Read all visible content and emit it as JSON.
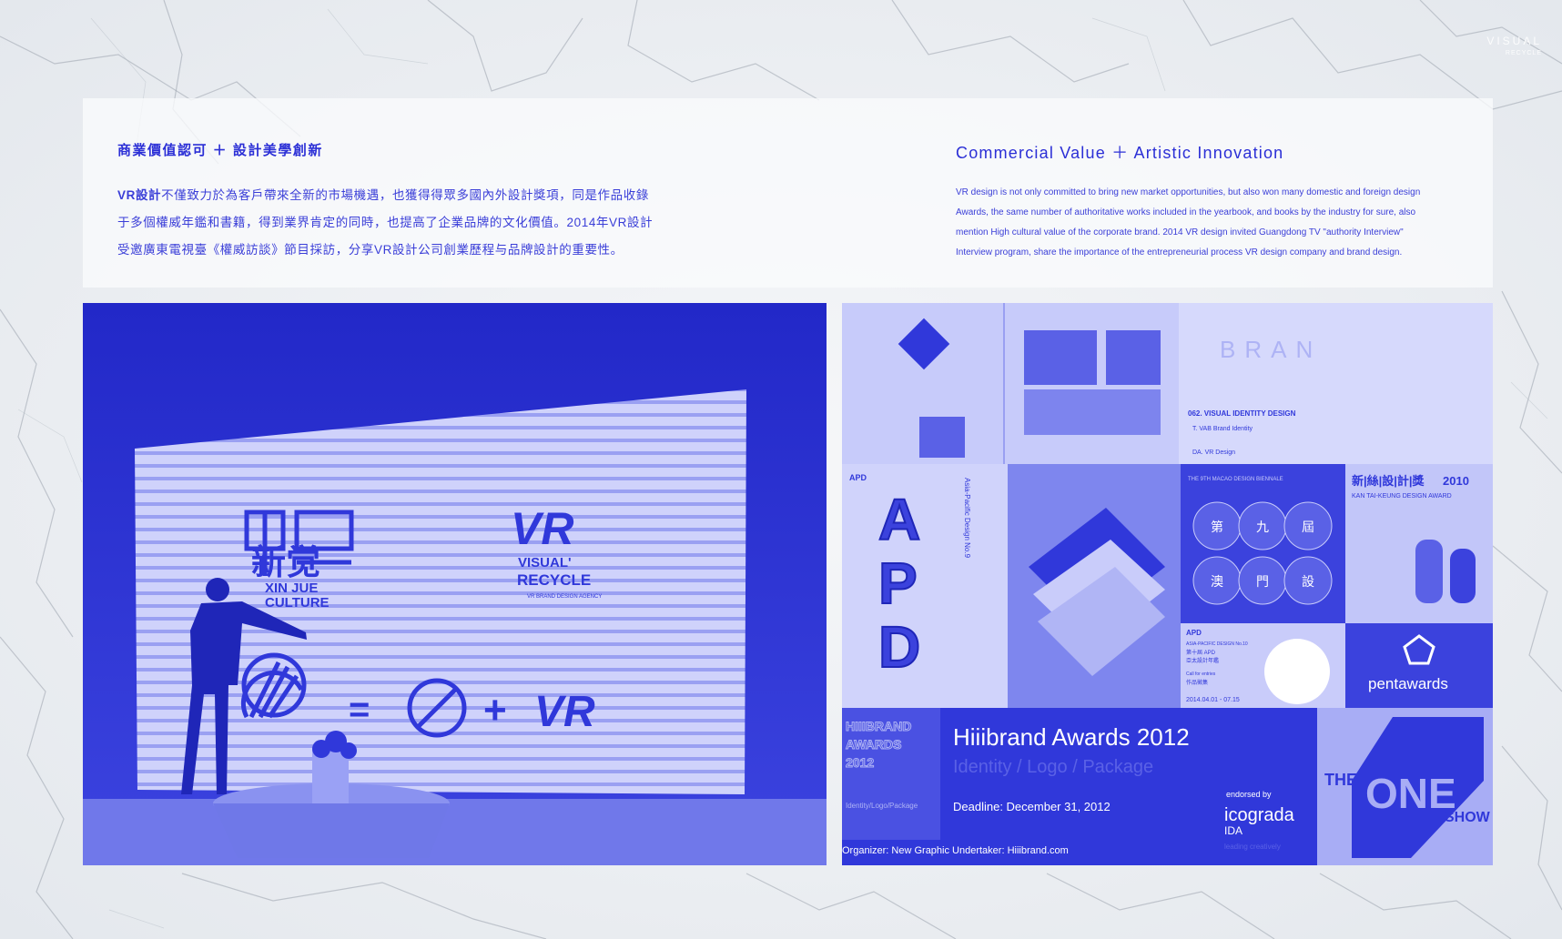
{
  "corner_logo": {
    "line1": "VISUAL",
    "line2": "RECYCLE"
  },
  "intro": {
    "zh": {
      "title": "商業價值認可 ＋ 設計美學創新",
      "lead": "VR設計",
      "body_line1": "不僅致力於為客戶帶來全新的市場機遇，也獲得得眾多國內外設計獎項，同是作品收錄",
      "body_line2": "于多個權威年鑑和書籍，得到業界肯定的同時，也提高了企業品牌的文化價值。2014年VR設計",
      "body_line3": "受邀廣東電視臺《權威訪談》節目採訪，分享VR設計公司創業歷程与品牌設計的重要性。"
    },
    "en": {
      "title": "Commercial Value ＋ Artistic Innovation",
      "body_line1": "VR design is not only committed to bring new market opportunities, but also won many domestic and foreign design",
      "body_line2": "Awards, the same number of authoritative works included in the yearbook, and books by the industry for sure, also",
      "body_line3": "mention High cultural value of the corporate brand. 2014 VR design invited Guangdong TV \"authority Interview\"",
      "body_line4": "Interview program, share the importance of the entrepreneurial process VR design company and brand design."
    }
  },
  "stage_photo": {
    "screen_logo_left_zh": "新觉",
    "screen_logo_left_en1": "XIN JUE",
    "screen_logo_left_en2": "CULTURE",
    "screen_logo_vr": "VR",
    "screen_logo_right_en1": "VISUAL'",
    "screen_logo_right_en2": "RECYCLE",
    "screen_logo_right_tag": "VR BRAND DESIGN AGENCY",
    "equation_equals": "=",
    "equation_plus": "+",
    "equation_vr": "VR"
  },
  "collage": {
    "book1_text": "062. VISUAL IDENTITY DESIGN",
    "book1_credit1": "T. VAB Brand Identity",
    "book1_credit2": "DA. VR Design",
    "book1_brand": "BRAN",
    "apd_letters": [
      "A",
      "P",
      "D"
    ],
    "apd_header": "APD",
    "apd_side": "Asia-Pacific Design No.9",
    "macau_header": "THE 9TH MACAO DESIGN BIENNALE",
    "macau_chars": [
      "第",
      "九",
      "屆",
      "澳",
      "門",
      "設"
    ],
    "kan_title": "新|絲|設|計|獎",
    "kan_year": "2010",
    "kan_sub": "KAN TAI-KEUNG DESIGN AWARD",
    "apd10_title": "APD",
    "apd10_line1": "ASIA-PACIFIC DESIGN No.10",
    "apd10_line2": "第十屆 APD",
    "apd10_line3": "亞太設計年鑑",
    "apd10_line4": "Call for entries",
    "apd10_line5": "作品徵集",
    "apd10_date": "2014.04.01 - 07.15",
    "pentawards": "pentawards",
    "hiii_left1": "HIIIBRAND",
    "hiii_left2": "AWARDS",
    "hiii_left3": "2012",
    "hiii_left4": "Identity/Logo/Package",
    "hiii_title": "Hiiibrand Awards 2012",
    "hiii_sub": "Identity / Logo / Package",
    "hiii_deadline": "Deadline: December 31, 2012",
    "hiii_endorsed": "endorsed by",
    "hiii_icograda": "icograda",
    "hiii_ida": "IDA",
    "hiii_leading": "leading creatively",
    "hiii_footer": "Organizer: New Graphic    Undertaker: Hiiibrand.com",
    "oneshow_the": "THE",
    "oneshow_one": "ONE",
    "oneshow_show": "SHOW"
  },
  "colors": {
    "brand_blue": "#2b2fd6",
    "photo_blue": "#3038da",
    "light_blue": "#8e95f0"
  }
}
